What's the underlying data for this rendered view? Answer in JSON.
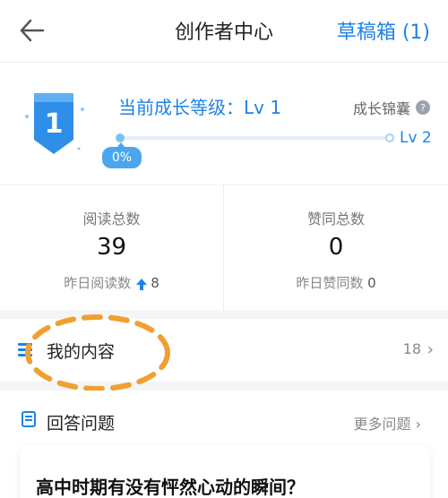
{
  "header": {
    "title": "创作者中心",
    "drafts_label": "草稿箱 (1)"
  },
  "level": {
    "badge_number": "1",
    "current_label": "当前成长等级：Lv 1",
    "growth_link": "成长锦囊",
    "help_glyph": "?",
    "next_level": "Lv 2",
    "progress_percent": "0%",
    "progress_value": 0,
    "accent_color": "#1f82e6"
  },
  "stats": {
    "reads": {
      "label": "阅读总数",
      "value": "39",
      "sub_label": "昨日阅读数",
      "sub_value": "8"
    },
    "likes": {
      "label": "赞同总数",
      "value": "0",
      "sub_label": "昨日赞同数",
      "sub_value": "0"
    }
  },
  "my_content": {
    "label": "我的内容",
    "count": "18",
    "chevron": "›"
  },
  "questions": {
    "label": "回答问题",
    "more_label": "更多问题",
    "chevron": "›",
    "first_question": "高中时期有没有怦然心动的瞬间？"
  }
}
